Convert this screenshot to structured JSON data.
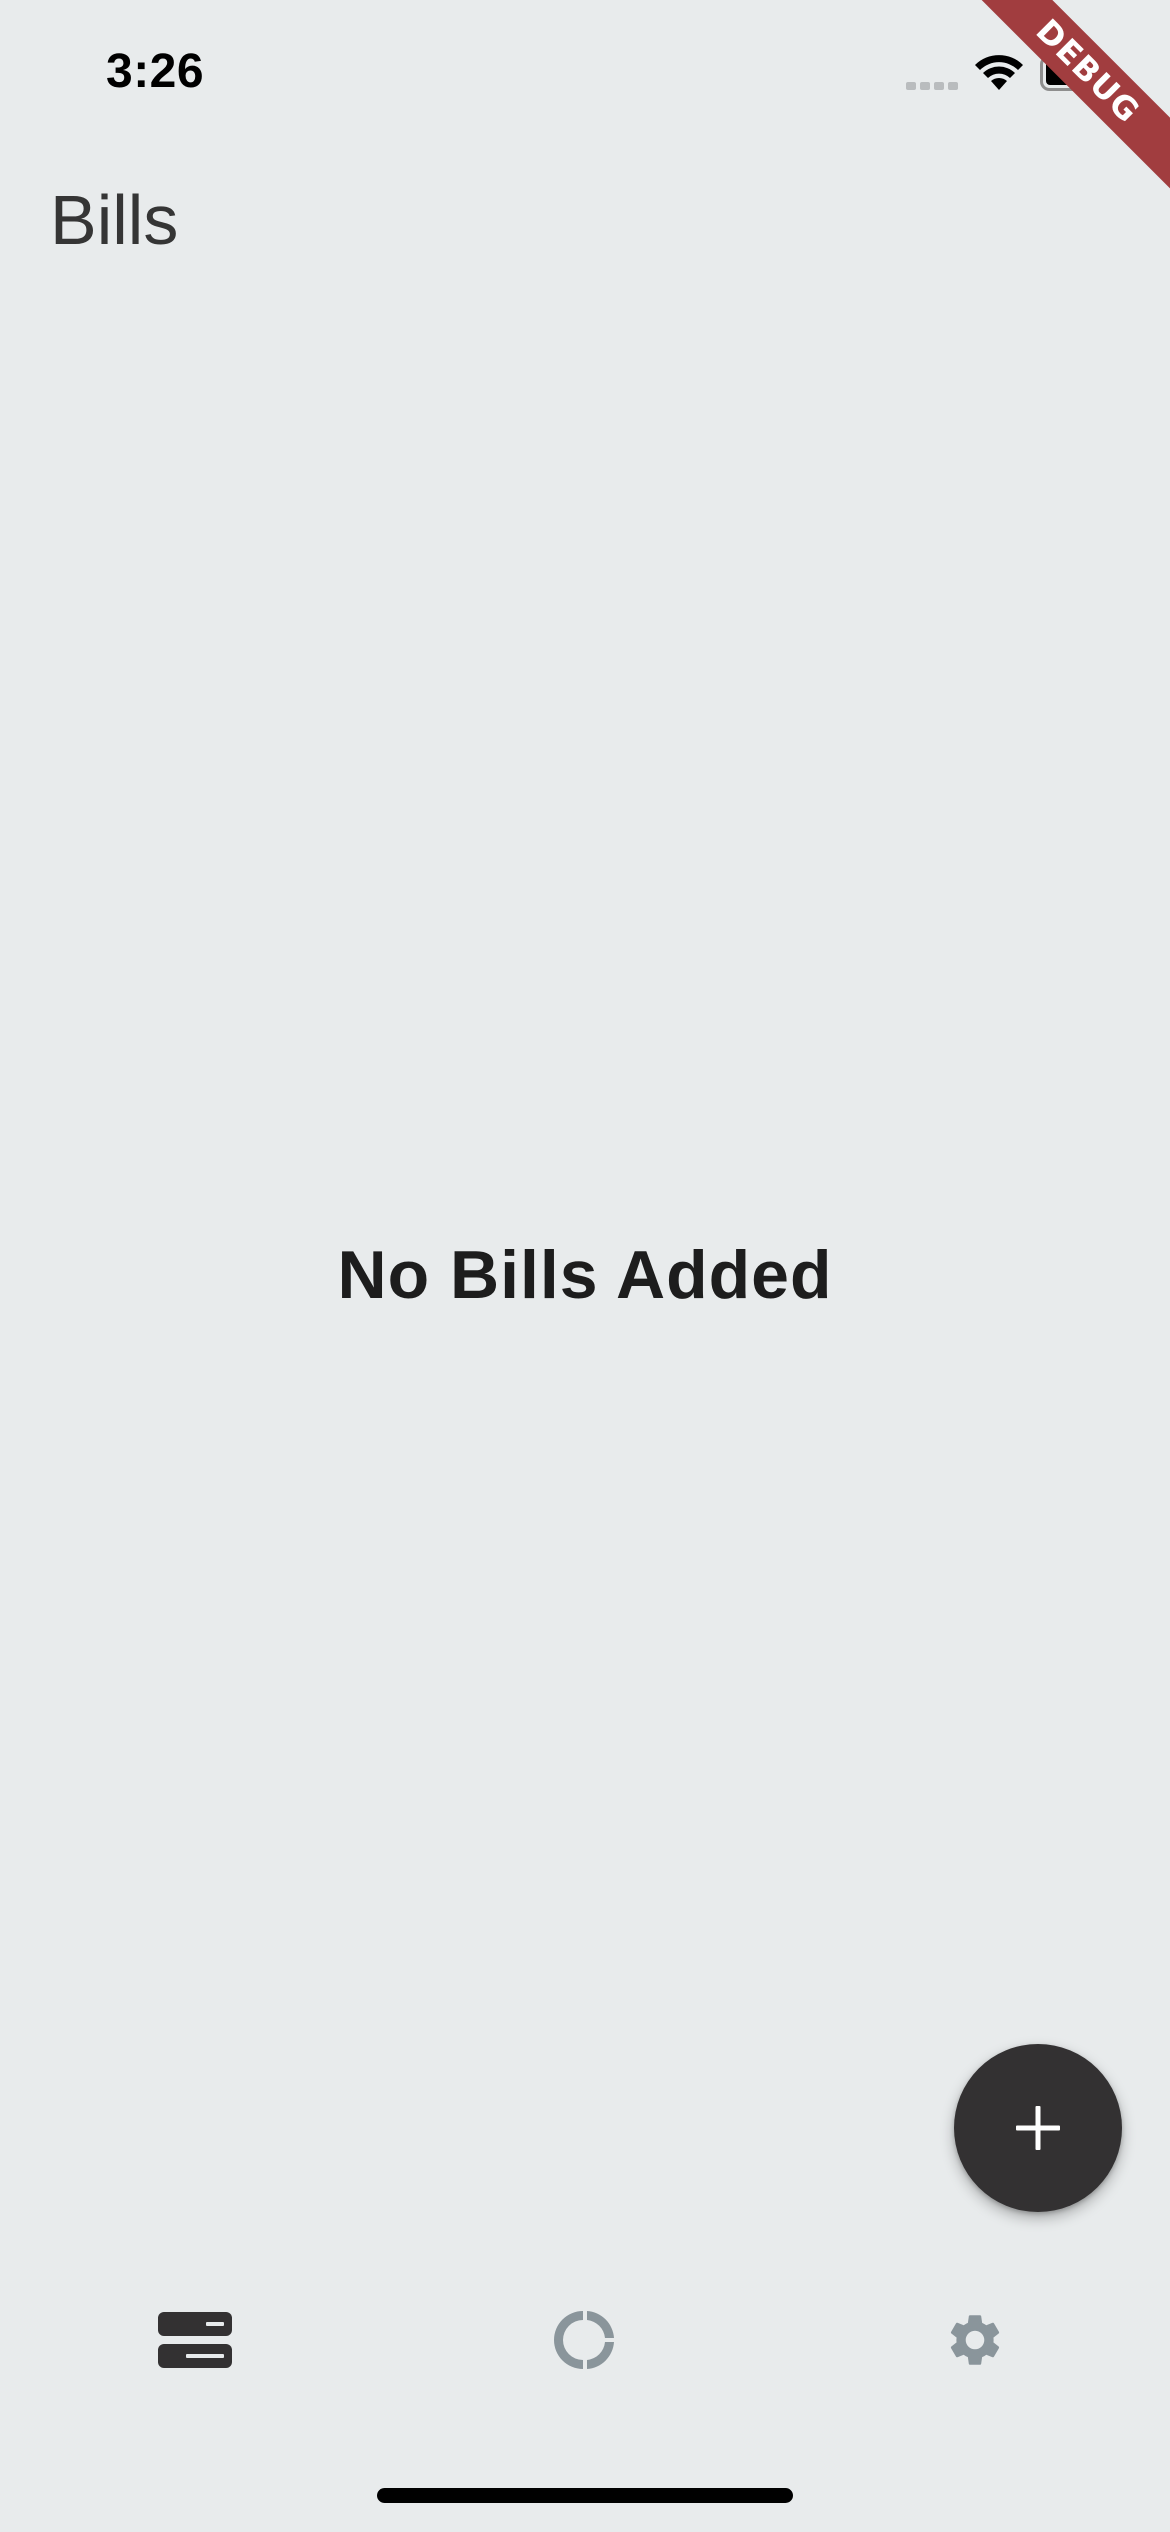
{
  "status_bar": {
    "time": "3:26"
  },
  "debug_banner": {
    "label": "DEBUG",
    "color": "#a13d3f"
  },
  "header": {
    "title": "Bills"
  },
  "main": {
    "empty_message": "No Bills Added"
  },
  "fab": {
    "icon": "plus-icon",
    "color": "#333132"
  },
  "bottom_nav": {
    "items": [
      {
        "icon": "bills-list-icon",
        "selected": true
      },
      {
        "icon": "donut-chart-icon",
        "selected": false
      },
      {
        "icon": "gear-icon",
        "selected": false
      }
    ],
    "active_color": "#333132",
    "inactive_color": "#8a959b"
  },
  "colors": {
    "background": "#e8ebec",
    "title_text": "#353535",
    "empty_text": "#1d1d1d"
  }
}
